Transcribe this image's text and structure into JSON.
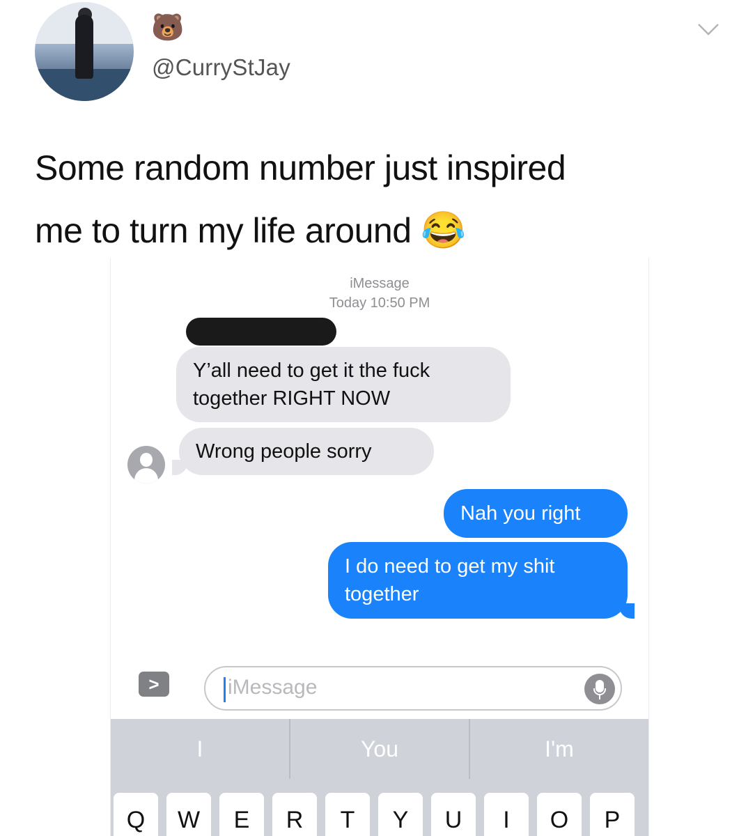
{
  "tweet": {
    "handle": "@CurryStJay",
    "name_emoji": "🐻",
    "text_line1": "Some random number just inspired",
    "text_line2": "me to turn my life around",
    "text_emoji": "😂"
  },
  "screenshot": {
    "service_label": "iMessage",
    "timestamp": "Today 10:50 PM",
    "messages": [
      {
        "direction": "received",
        "text_line1": "Y’all need to get it the fuck",
        "text_line2": "together RIGHT NOW"
      },
      {
        "direction": "received",
        "text": "Wrong people sorry"
      },
      {
        "direction": "sent",
        "text": "Nah you right"
      },
      {
        "direction": "sent",
        "text_line1": "I do need to get my shit",
        "text_line2": "together"
      }
    ],
    "apps_button": ">",
    "input_placeholder": "iMessage",
    "predictions": [
      "I",
      "You",
      "I'm"
    ],
    "keys": [
      "Q",
      "W",
      "E",
      "R",
      "T",
      "Y",
      "U",
      "I",
      "O",
      "P"
    ]
  },
  "colors": {
    "sent_bubble": "#1a82fb",
    "received_bubble": "#e5e5ea"
  },
  "icons": [
    "avatar",
    "bear-emoji",
    "chevron-down-icon",
    "contact-icon",
    "apps-icon",
    "microphone-icon"
  ]
}
